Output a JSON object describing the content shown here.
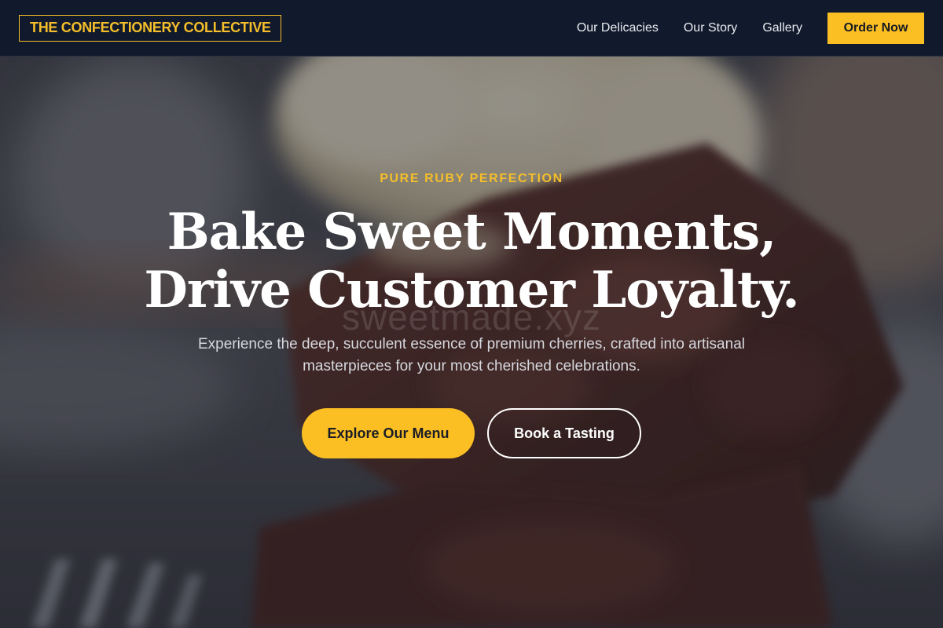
{
  "nav": {
    "brand": "THE CONFECTIONERY COLLECTIVE",
    "links": [
      "Our Delicacies",
      "Our Story",
      "Gallery"
    ],
    "order_button": "Order Now"
  },
  "hero": {
    "eyebrow": "PURE RUBY PERFECTION",
    "headline_line1": "Bake Sweet Moments,",
    "headline_line2": "Drive Customer Loyalty.",
    "watermark": "sweetmade.xyz",
    "subtext": "Experience the deep, succulent essence of premium cherries, crafted into artisanal masterpieces for your most cherished celebrations.",
    "primary_button": "Explore Our Menu",
    "secondary_button": "Book a Tasting",
    "background_image": "brownie-with-ice-cream-photo"
  },
  "colors": {
    "accent": "#fbbf24",
    "nav_background": "#111a2c",
    "text_light": "#ffffff"
  }
}
